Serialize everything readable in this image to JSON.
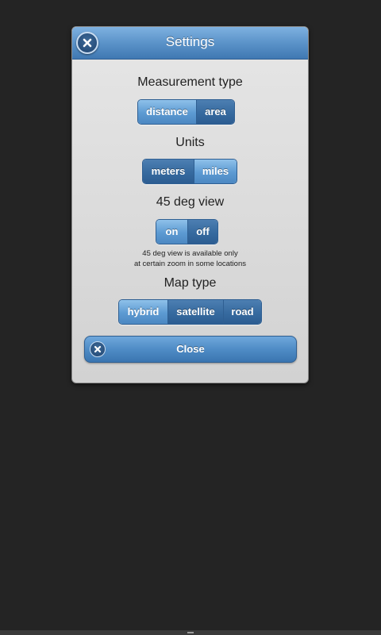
{
  "dialog": {
    "title": "Settings",
    "close_icon": "close-icon"
  },
  "measurement": {
    "label": "Measurement type",
    "options": [
      "distance",
      "area"
    ],
    "selected": "area"
  },
  "units": {
    "label": "Units",
    "options": [
      "meters",
      "miles"
    ],
    "selected": "meters"
  },
  "view45": {
    "label": "45 deg view",
    "options": [
      "on",
      "off"
    ],
    "selected": "off",
    "note_line1": "45 deg view is available only",
    "note_line2": "at certain zoom in some locations"
  },
  "maptype": {
    "label": "Map type",
    "options": [
      "hybrid",
      "satellite",
      "road"
    ],
    "selected": "satellite"
  },
  "close_button": {
    "label": "Close",
    "icon": "close-icon"
  },
  "colors": {
    "header": "#5b93c9",
    "segment_selected": "#366a9f",
    "segment_unselected": "#5c9ad2",
    "dialog_bg": "#dcdcdc",
    "page_bg": "#242424"
  }
}
